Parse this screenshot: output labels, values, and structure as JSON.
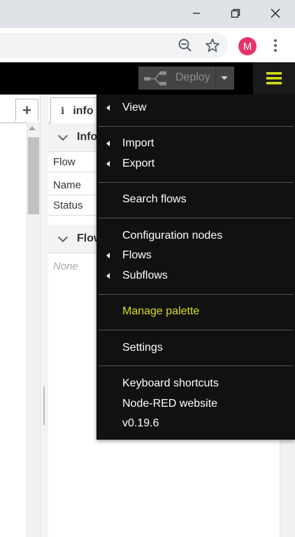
{
  "browser": {
    "window_controls": [
      "minimize",
      "restore",
      "close"
    ],
    "toolbar_icons": [
      "zoom-out-icon",
      "star-icon",
      "more-icon"
    ],
    "profile_initial": "M",
    "colors": {
      "avatar": "#e8336d",
      "tab_strip": "#dee1e6"
    }
  },
  "header": {
    "deploy_label": "Deploy",
    "colors": {
      "background": "#000000",
      "menu_icon": "#d4df17"
    }
  },
  "workspace": {
    "add_tab_label": "+"
  },
  "sidebar": {
    "tab": {
      "icon": "i",
      "label": "info"
    },
    "sections": [
      {
        "title": "Infor",
        "rows": [
          "Flow",
          "Name",
          "Status"
        ]
      },
      {
        "title": "Flow",
        "empty_text": "None"
      }
    ]
  },
  "menu": {
    "items": [
      {
        "label": "View",
        "submenu": true
      },
      {
        "label": "Import",
        "submenu": true
      },
      {
        "label": "Export",
        "submenu": true
      },
      {
        "label": "Search flows",
        "submenu": false
      },
      {
        "label": "Configuration nodes",
        "submenu": false
      },
      {
        "label": "Flows",
        "submenu": true
      },
      {
        "label": "Subflows",
        "submenu": true
      },
      {
        "label": "Manage palette",
        "submenu": false,
        "highlighted": true
      },
      {
        "label": "Settings",
        "submenu": false
      },
      {
        "label": "Keyboard shortcuts",
        "submenu": false
      },
      {
        "label": "Node-RED website",
        "submenu": false
      },
      {
        "label": "v0.19.6",
        "submenu": false
      }
    ],
    "colors": {
      "background": "#111111",
      "highlight_text": "#d4df17"
    }
  }
}
